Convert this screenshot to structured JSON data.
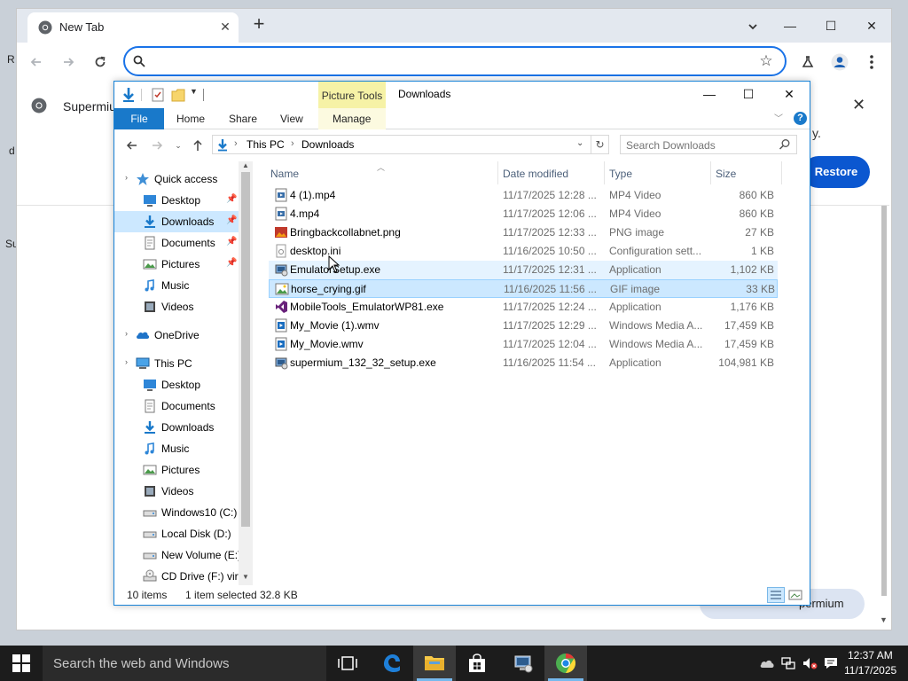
{
  "desktop": {
    "fragments": [
      "R",
      "d",
      "Su"
    ]
  },
  "browser": {
    "tab_title": "New Tab",
    "tab_close": "✕",
    "new_tab": "+",
    "tab_search": "⌄",
    "minimize": "—",
    "maximize": "☐",
    "close": "✕",
    "omnibox_value": "",
    "omnibox_placeholder": "",
    "suggestion": {
      "label": "Supermium",
      "close": "✕",
      "dot": "y.",
      "restore_label": "Restore"
    },
    "bottom_pill_label": "permium"
  },
  "explorer": {
    "title": "Downloads",
    "contextual_tab_group": "Picture Tools",
    "ribbon_tabs": [
      "File",
      "Home",
      "Share",
      "View",
      "Manage"
    ],
    "minimize": "—",
    "maximize": "☐",
    "close": "✕",
    "help": "?",
    "address": {
      "crumbs": [
        "This PC",
        "Downloads"
      ],
      "refresh": "↻"
    },
    "search_placeholder": "Search Downloads",
    "nav_pane": [
      {
        "label": "Quick access",
        "icon": "star-icon",
        "indent": 1,
        "pinned": false,
        "selected": false
      },
      {
        "label": "Desktop",
        "icon": "desktop-icon",
        "indent": 2,
        "pinned": true,
        "selected": false
      },
      {
        "label": "Downloads",
        "icon": "download-icon",
        "indent": 2,
        "pinned": true,
        "selected": true
      },
      {
        "label": "Documents",
        "icon": "documents-icon",
        "indent": 2,
        "pinned": true,
        "selected": false
      },
      {
        "label": "Pictures",
        "icon": "pictures-icon",
        "indent": 2,
        "pinned": true,
        "selected": false
      },
      {
        "label": "Music",
        "icon": "music-icon",
        "indent": 2,
        "pinned": false,
        "selected": false
      },
      {
        "label": "Videos",
        "icon": "videos-icon",
        "indent": 2,
        "pinned": false,
        "selected": false
      },
      {
        "label": "OneDrive",
        "icon": "onedrive-icon",
        "indent": 1,
        "pinned": false,
        "selected": false
      },
      {
        "label": "This PC",
        "icon": "pc-icon",
        "indent": 1,
        "pinned": false,
        "selected": false
      },
      {
        "label": "Desktop",
        "icon": "desktop-icon",
        "indent": 2,
        "pinned": false,
        "selected": false
      },
      {
        "label": "Documents",
        "icon": "documents-icon",
        "indent": 2,
        "pinned": false,
        "selected": false
      },
      {
        "label": "Downloads",
        "icon": "download-icon",
        "indent": 2,
        "pinned": false,
        "selected": false
      },
      {
        "label": "Music",
        "icon": "music-icon",
        "indent": 2,
        "pinned": false,
        "selected": false
      },
      {
        "label": "Pictures",
        "icon": "pictures-icon",
        "indent": 2,
        "pinned": false,
        "selected": false
      },
      {
        "label": "Videos",
        "icon": "videos-icon",
        "indent": 2,
        "pinned": false,
        "selected": false
      },
      {
        "label": "Windows10 (C:)",
        "icon": "drive-icon",
        "indent": 2,
        "pinned": false,
        "selected": false
      },
      {
        "label": "Local Disk (D:)",
        "icon": "drive-icon",
        "indent": 2,
        "pinned": false,
        "selected": false
      },
      {
        "label": "New Volume (E:)",
        "icon": "drive-icon",
        "indent": 2,
        "pinned": false,
        "selected": false
      },
      {
        "label": "CD Drive (F:) virt",
        "icon": "cd-drive-icon",
        "indent": 2,
        "pinned": false,
        "selected": false
      }
    ],
    "columns": [
      "Name",
      "Date modified",
      "Type",
      "Size"
    ],
    "files": [
      {
        "name": "4 (1).mp4",
        "date": "11/17/2025 12:28 ...",
        "type": "MP4 Video",
        "size": "860 KB",
        "icon": "video-file-icon",
        "state": ""
      },
      {
        "name": "4.mp4",
        "date": "11/17/2025 12:06 ...",
        "type": "MP4 Video",
        "size": "860 KB",
        "icon": "video-file-icon",
        "state": ""
      },
      {
        "name": "Bringbackcollabnet.png",
        "date": "11/17/2025 12:33 ...",
        "type": "PNG image",
        "size": "27 KB",
        "icon": "image-file-icon",
        "state": ""
      },
      {
        "name": "desktop.ini",
        "date": "11/16/2025 10:50 ...",
        "type": "Configuration sett...",
        "size": "1 KB",
        "icon": "ini-file-icon",
        "state": ""
      },
      {
        "name": "EmulatorSetup.exe",
        "date": "11/17/2025 12:31 ...",
        "type": "Application",
        "size": "1,102 KB",
        "icon": "setup-exe-icon",
        "state": "hover"
      },
      {
        "name": "horse_crying.gif",
        "date": "11/16/2025 11:56 ...",
        "type": "GIF image",
        "size": "33 KB",
        "icon": "gif-file-icon",
        "state": "selected"
      },
      {
        "name": "MobileTools_EmulatorWP81.exe",
        "date": "11/17/2025 12:24 ...",
        "type": "Application",
        "size": "1,176 KB",
        "icon": "vs-exe-icon",
        "state": ""
      },
      {
        "name": "My_Movie (1).wmv",
        "date": "11/17/2025 12:29 ...",
        "type": "Windows Media A...",
        "size": "17,459 KB",
        "icon": "wmv-file-icon",
        "state": ""
      },
      {
        "name": "My_Movie.wmv",
        "date": "11/17/2025 12:04 ...",
        "type": "Windows Media A...",
        "size": "17,459 KB",
        "icon": "wmv-file-icon",
        "state": ""
      },
      {
        "name": "supermium_132_32_setup.exe",
        "date": "11/16/2025 11:54 ...",
        "type": "Application",
        "size": "104,981 KB",
        "icon": "setup-exe-icon",
        "state": ""
      }
    ],
    "status": {
      "count": "10 items",
      "selected": "1 item selected",
      "size": "32.8 KB"
    }
  },
  "taskbar": {
    "search_placeholder": "Search the web and Windows",
    "time": "12:37 AM",
    "date": "11/17/2025"
  },
  "colors": {
    "accent": "#1979ca",
    "selection": "#cce8ff",
    "chrome_focus": "#1a73e8",
    "restore": "#0b57d0"
  }
}
